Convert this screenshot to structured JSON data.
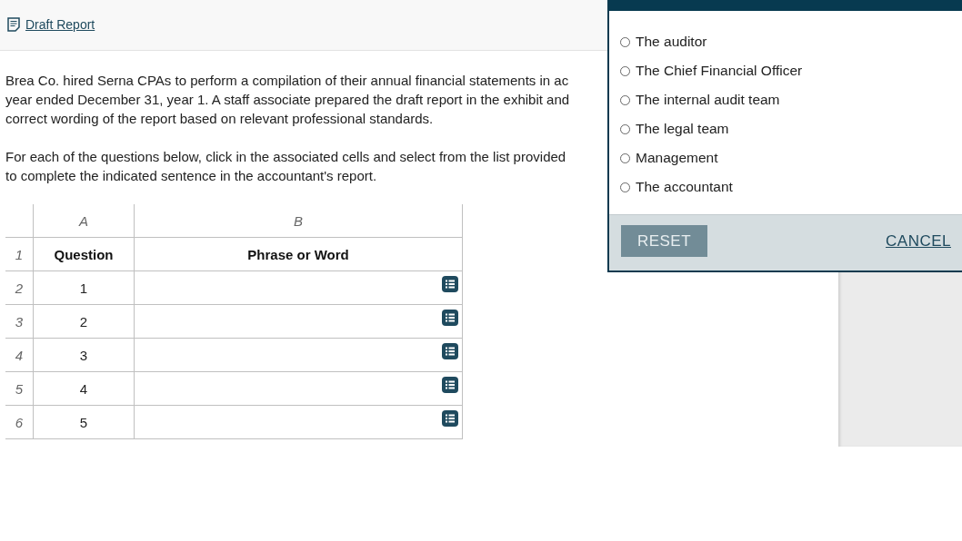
{
  "header": {
    "link": "Draft Report"
  },
  "instructions": [
    [
      "Brea Co. hired Serna CPAs to perform a compilation of their annual financial statements in ac",
      "year ended December 31, year 1. A staff associate prepared the draft report in the exhibit and",
      "correct wording of the report based on relevant professional standards."
    ],
    [
      "For each of the questions below, click in the associated cells and select from the list provided",
      "to complete the indicated sentence in the accountant's report."
    ]
  ],
  "table": {
    "columns": [
      "A",
      "B"
    ],
    "header_row": {
      "number": "1",
      "cells": [
        "Question",
        "Phrase or Word"
      ]
    },
    "rows": [
      {
        "number": "2",
        "question": "1"
      },
      {
        "number": "3",
        "question": "2"
      },
      {
        "number": "4",
        "question": "3"
      },
      {
        "number": "5",
        "question": "4"
      },
      {
        "number": "6",
        "question": "5"
      }
    ]
  },
  "popup": {
    "options": [
      {
        "label": "The auditor",
        "selected": false
      },
      {
        "label": "The Chief Financial Officer",
        "selected": false
      },
      {
        "label": "The internal audit team",
        "selected": false
      },
      {
        "label": "The legal team",
        "selected": false
      },
      {
        "label": "Management",
        "selected": false
      },
      {
        "label": "The accountant",
        "selected": false
      }
    ],
    "reset": "RESET",
    "cancel": "CANCEL"
  }
}
